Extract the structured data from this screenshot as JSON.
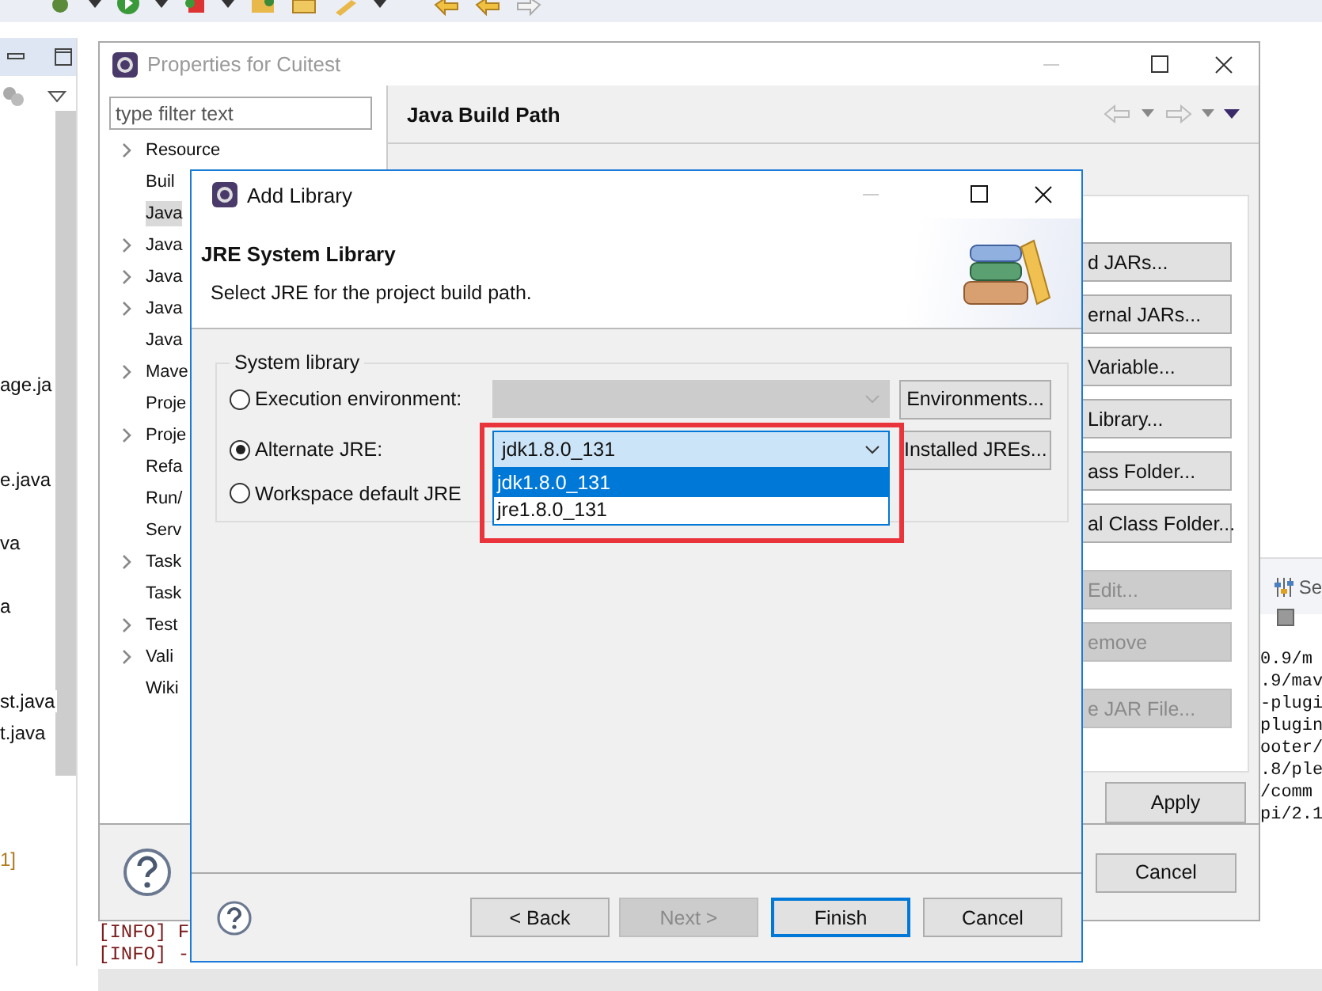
{
  "explorer_items": [
    "age.ja",
    "e.java",
    "va",
    "a",
    "st.java",
    "t.java",
    "1]"
  ],
  "console_lines": [
    "[INFO] F",
    "[INFO] -"
  ],
  "side_view": {
    "tab": "Se",
    "lines": [
      "0.9/m",
      ".9/mav",
      "-plugi",
      "plugin",
      "ooter/",
      ".8/ple",
      "/comm",
      "pi/2.1"
    ]
  },
  "properties": {
    "title": "Properties for Cuitest",
    "filter_placeholder": "type filter text",
    "tree": [
      {
        "label": "Resource",
        "expandable": true,
        "selected": false
      },
      {
        "label": "Buil",
        "expandable": false,
        "selected": false
      },
      {
        "label": "Java",
        "expandable": false,
        "selected": true
      },
      {
        "label": "Java",
        "expandable": true,
        "selected": false
      },
      {
        "label": "Java",
        "expandable": true,
        "selected": false
      },
      {
        "label": "Java",
        "expandable": true,
        "selected": false
      },
      {
        "label": "Java",
        "expandable": false,
        "selected": false
      },
      {
        "label": "Mave",
        "expandable": true,
        "selected": false
      },
      {
        "label": "Proje",
        "expandable": false,
        "selected": false
      },
      {
        "label": "Proje",
        "expandable": true,
        "selected": false
      },
      {
        "label": "Refa",
        "expandable": false,
        "selected": false
      },
      {
        "label": "Run/",
        "expandable": false,
        "selected": false
      },
      {
        "label": "Serv",
        "expandable": false,
        "selected": false
      },
      {
        "label": "Task",
        "expandable": true,
        "selected": false
      },
      {
        "label": "Task",
        "expandable": false,
        "selected": false
      },
      {
        "label": "Test",
        "expandable": true,
        "selected": false
      },
      {
        "label": "Vali",
        "expandable": true,
        "selected": false
      },
      {
        "label": "Wiki",
        "expandable": false,
        "selected": false
      }
    ],
    "header": "Java Build Path",
    "button_groups": [
      [
        {
          "label": "d JARs...",
          "disabled": false
        },
        {
          "label": "ernal JARs...",
          "disabled": false
        },
        {
          "label": "Variable...",
          "disabled": false
        },
        {
          "label": "Library...",
          "disabled": false
        },
        {
          "label": "ass Folder...",
          "disabled": false
        },
        {
          "label": "al Class Folder...",
          "disabled": false
        }
      ],
      [
        {
          "label": "Edit...",
          "disabled": true
        },
        {
          "label": "emove",
          "disabled": true
        }
      ],
      [
        {
          "label": "e JAR File...",
          "disabled": true
        }
      ]
    ],
    "apply": "Apply",
    "cancel": "Cancel"
  },
  "dialog": {
    "title": "Add Library",
    "header": "JRE System Library",
    "description": "Select JRE for the project build path.",
    "group_label": "System library",
    "options": [
      {
        "label": "Execution environment:",
        "selected": false,
        "combo": {
          "disabled": true,
          "open": false
        },
        "button": "Environments..."
      },
      {
        "label": "Alternate JRE:",
        "selected": true,
        "combo": {
          "value": "jdk1.8.0_131",
          "disabled": false,
          "open": true,
          "items": [
            {
              "label": "jdk1.8.0_131",
              "selected": true
            },
            {
              "label": "jre1.8.0_131",
              "selected": false
            }
          ]
        },
        "button": "Installed JREs..."
      },
      {
        "label": "Workspace default JRE",
        "selected": false
      }
    ],
    "buttons": [
      {
        "label": "< Back",
        "disabled": false,
        "default": false
      },
      {
        "label": "Next >",
        "disabled": true,
        "default": false
      },
      {
        "label": "Finish",
        "disabled": false,
        "default": true
      },
      {
        "label": "Cancel",
        "disabled": false,
        "default": false
      }
    ]
  }
}
